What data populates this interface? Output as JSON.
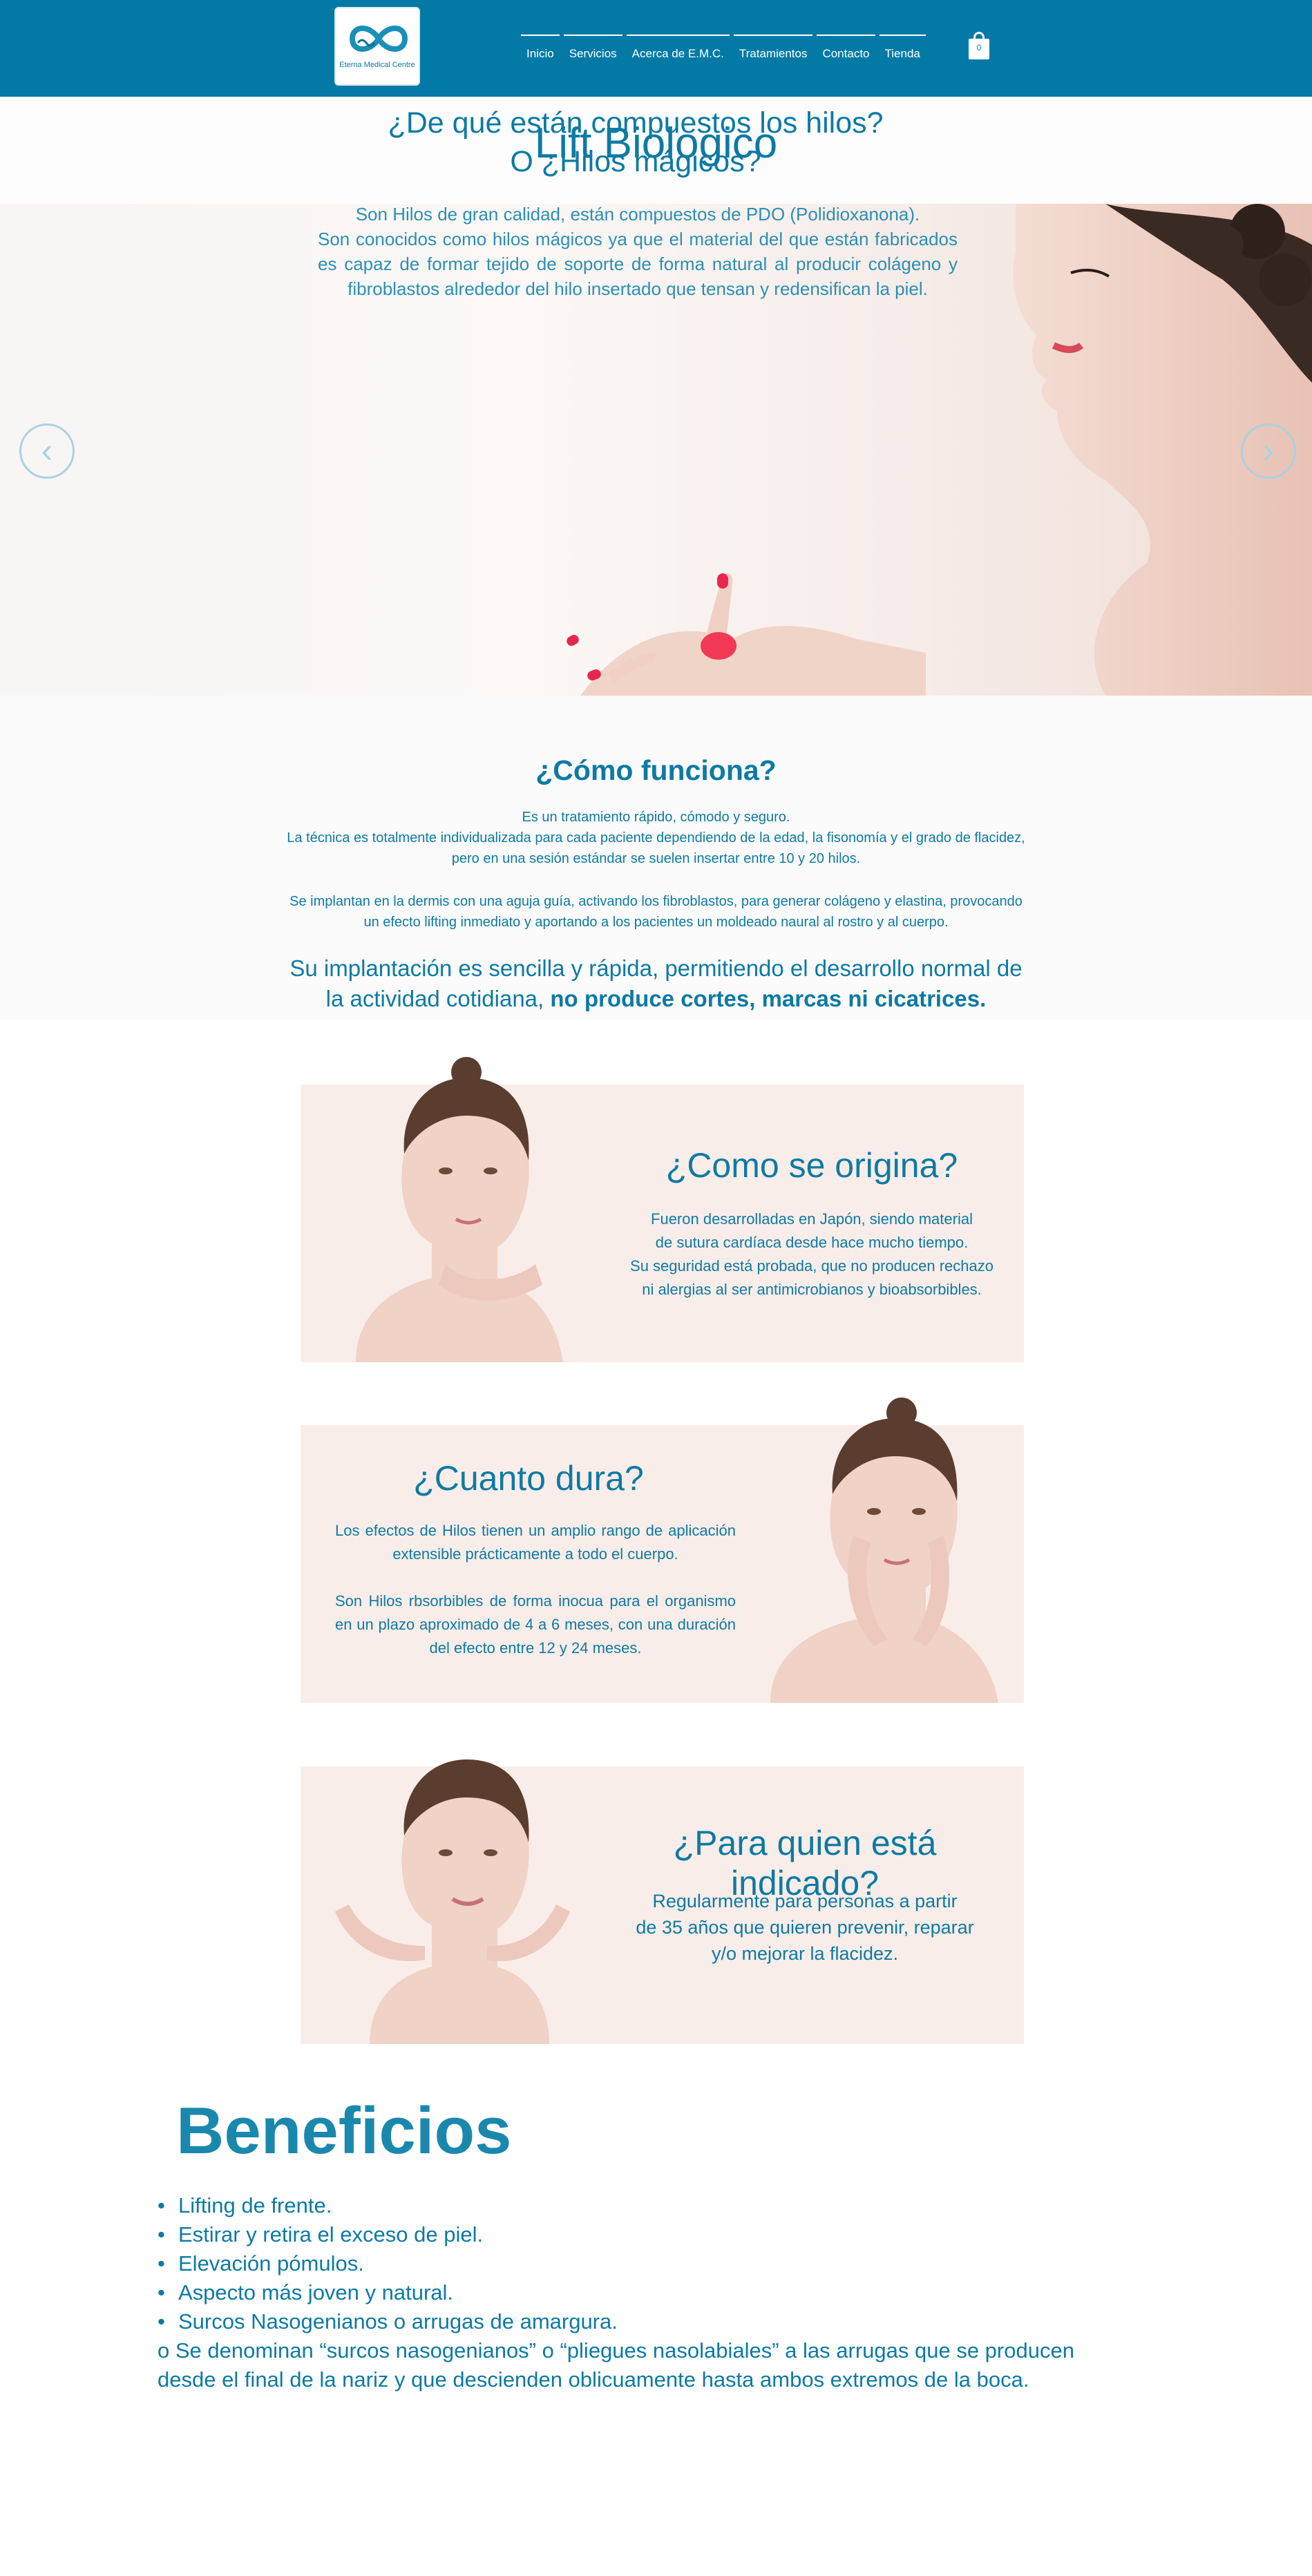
{
  "header": {
    "logo_text": "Eterna Medical Centre",
    "nav": [
      "Inicio",
      "Servicios",
      "Acerca de E.M.C.",
      "Tratamientos",
      "Contacto",
      "Tienda"
    ],
    "cart_count": "0",
    "colors": {
      "bar": "#037aa6",
      "text": "#ffffff"
    }
  },
  "page": {
    "title": "Lift Biologico"
  },
  "hero": {
    "heading_line1": "¿De qué están compuestos los hilos?",
    "heading_line2": "O ¿Hilos mágicos?",
    "text_line1": "Son Hilos de gran calidad, están compuestos de PDO (Polidioxanona).",
    "text_rest": "Son conocidos como hilos mágicos ya que el material del que están fabricados es capaz de formar tejido de soporte de forma natural al producir colágeno y fibroblastos alrededor del hilo insertado que tensan y redensifican la piel.",
    "prev_icon": "chevron-left-icon",
    "next_icon": "chevron-right-icon"
  },
  "how": {
    "heading": "¿Cómo funciona?",
    "p1_line1": "Es un tratamiento rápido, cómodo y seguro.",
    "p1_line2": "La técnica es totalmente individualizada para cada paciente dependiendo de la edad, la fisonomía y el grado de flacidez, pero en una sesión estándar se suelen insertar entre 10 y 20 hilos.",
    "p2": "Se implantan en la dermis con una aguja guía, activando los fibroblastos, para generar colágeno y elastina, provocando un efecto lifting inmediato y aportando a los pacientes un moldeado naural al rostro y al cuerpo.",
    "emph_plain": "Su implantación es sencilla y rápida, permitiendo el desarrollo normal de la actividad cotidiana, ",
    "emph_bold": "no produce cortes, marcas ni cicatrices."
  },
  "cards": {
    "origin": {
      "heading": "¿Como se origina?",
      "lines": [
        "Fueron desarrolladas en Japón, siendo material",
        "de sutura cardíaca desde hace mucho tiempo.",
        "Su seguridad está probada, que no producen rechazo",
        "ni alergias al ser antimicrobianos y bioabsorbibles."
      ]
    },
    "duration": {
      "heading": "¿Cuanto dura?",
      "p1": "Los efectos de Hilos tienen un amplio rango de aplicación extensible prácticamente a todo el cuerpo.",
      "p2": "Son Hilos rbsorbibles de forma inocua para el organismo en un plazo aproximado de 4 a 6 meses, con una duración del efecto entre 12 y 24 meses."
    },
    "indicated": {
      "heading": "¿Para quien está indicado?",
      "lines": [
        "Regularmente para personas a partir",
        "de 35 años que quieren prevenir, reparar",
        "y/o mejorar la flacidez."
      ]
    }
  },
  "benefits": {
    "heading": "Beneficios",
    "items": [
      "Lifting de frente.",
      "Estirar y retira el exceso de piel.",
      "Elevación pómulos.",
      "Aspecto más joven y natural.",
      "Surcos Nasogenianos o arrugas de amargura."
    ],
    "bullet": "•",
    "note": "o  Se denominan “surcos nasogenianos” o “pliegues nasolabiales” a las arrugas que se producen desde el final de la nariz y que descienden oblicuamente hasta ambos extremos de la boca."
  }
}
